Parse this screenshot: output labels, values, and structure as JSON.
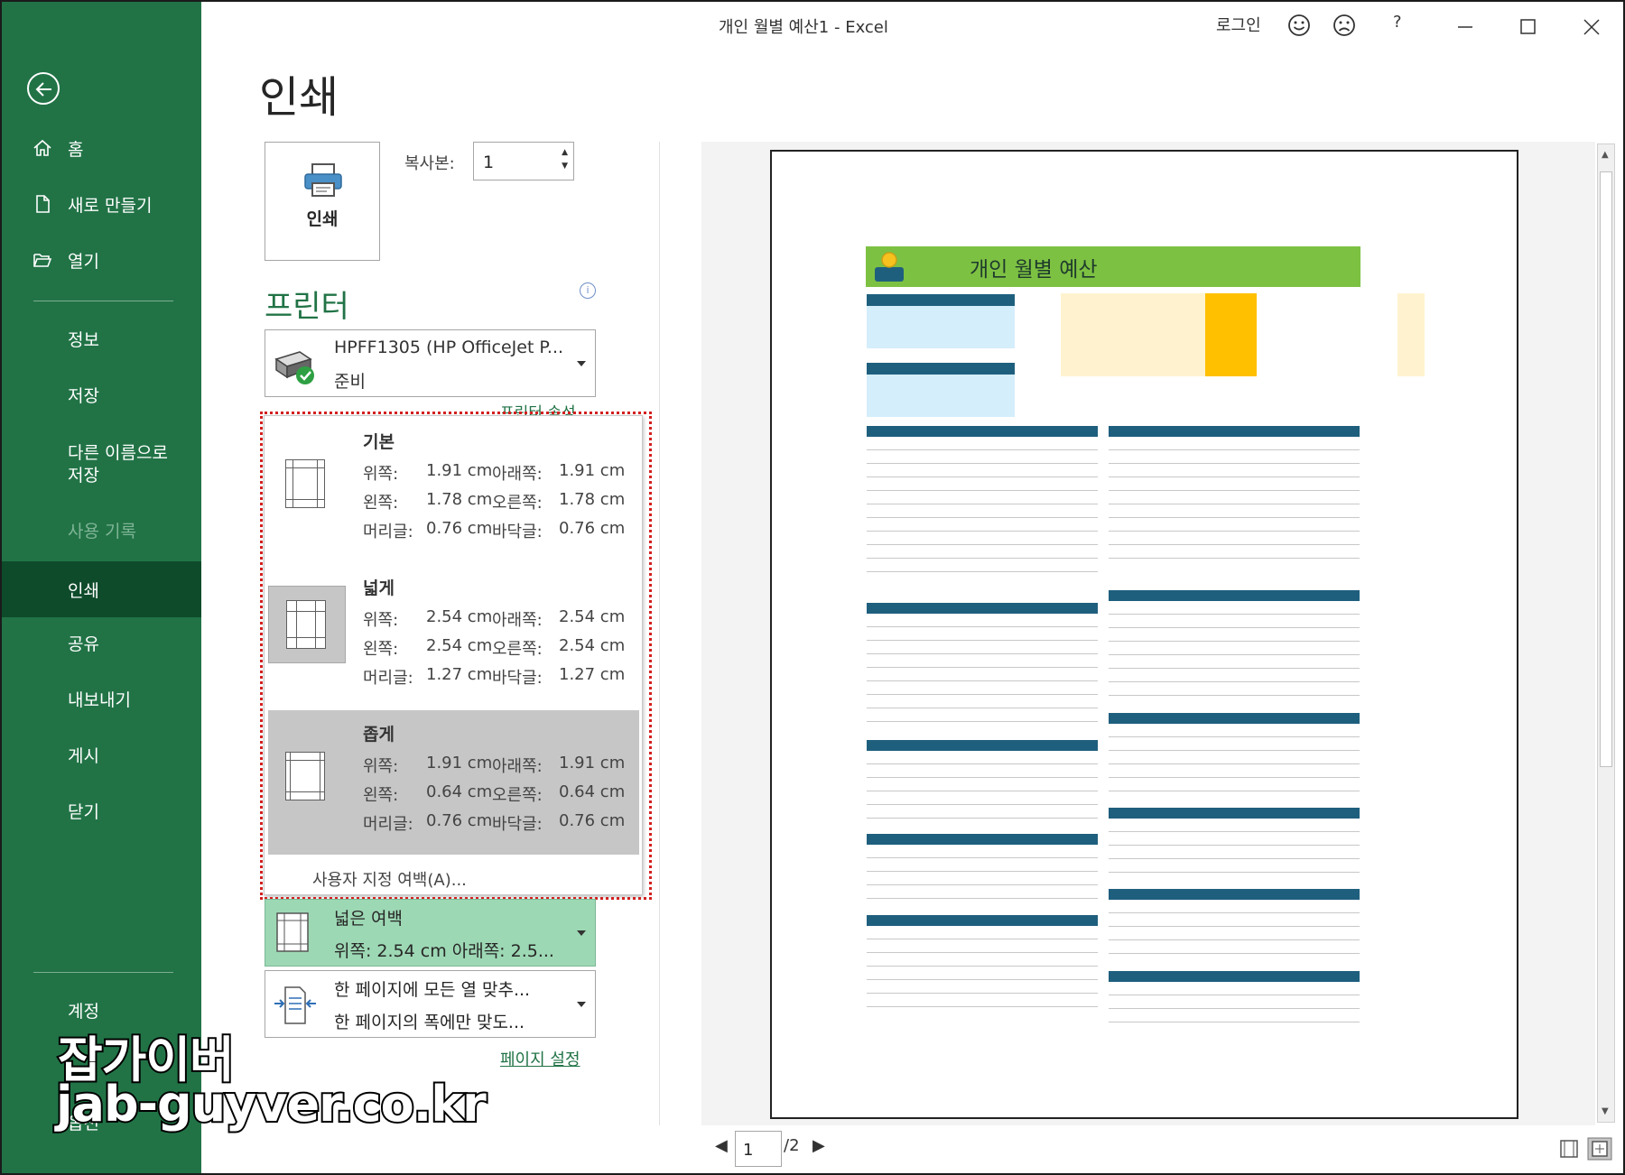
{
  "window": {
    "title": "개인 월별 예산1  -  Excel",
    "signin": "로그인",
    "help": "?"
  },
  "sidebar": {
    "items": [
      {
        "label": "홈",
        "icon": "home-icon"
      },
      {
        "label": "새로 만들기",
        "icon": "new-file-icon"
      },
      {
        "label": "열기",
        "icon": "open-folder-icon"
      },
      {
        "label": "정보"
      },
      {
        "label": "저장"
      },
      {
        "label": "다른 이름으로\n저장"
      },
      {
        "label": "사용 기록"
      },
      {
        "label": "인쇄"
      },
      {
        "label": "공유"
      },
      {
        "label": "내보내기"
      },
      {
        "label": "게시"
      },
      {
        "label": "닫기"
      },
      {
        "label": "계정"
      },
      {
        "label": "옵션"
      }
    ]
  },
  "print": {
    "heading": "인쇄",
    "button_label": "인쇄",
    "copies_label": "복사본:",
    "copies_value": "1",
    "printer_heading": "프린터",
    "printer_name": "HPFF1305 (HP OfficeJet P...",
    "printer_status": "준비",
    "printer_props": "프린터 속성"
  },
  "margins_menu": {
    "options": [
      {
        "name": "기본",
        "top_label": "위쪽:",
        "top": "1.91 cm",
        "bottom_label": "아래쪽:",
        "bottom": "1.91 cm",
        "left_label": "왼쪽:",
        "left": "1.78 cm",
        "right_label": "오른쪽:",
        "right": "1.78 cm",
        "header_label": "머리글:",
        "header": "0.76 cm",
        "footer_label": "바닥글:",
        "footer": "0.76 cm"
      },
      {
        "name": "넓게",
        "top_label": "위쪽:",
        "top": "2.54 cm",
        "bottom_label": "아래쪽:",
        "bottom": "2.54 cm",
        "left_label": "왼쪽:",
        "left": "2.54 cm",
        "right_label": "오른쪽:",
        "right": "2.54 cm",
        "header_label": "머리글:",
        "header": "1.27 cm",
        "footer_label": "바닥글:",
        "footer": "1.27 cm"
      },
      {
        "name": "좁게",
        "top_label": "위쪽:",
        "top": "1.91 cm",
        "bottom_label": "아래쪽:",
        "bottom": "1.91 cm",
        "left_label": "왼쪽:",
        "left": "0.64 cm",
        "right_label": "오른쪽:",
        "right": "0.64 cm",
        "header_label": "머리글:",
        "header": "0.76 cm",
        "footer_label": "바닥글:",
        "footer": "0.76 cm"
      }
    ],
    "custom": "사용자 지정 여백(A)..."
  },
  "settings": {
    "margins_title": "넓은 여백",
    "margins_detail": "위쪽: 2.54 cm 아래쪽: 2.5...",
    "scaling_title": "한 페이지에 모든 열 맞추...",
    "scaling_detail": "한 페이지의 폭에만 맞도...",
    "page_setup": "페이지 설정"
  },
  "preview": {
    "sheet_title": "개인 월별 예산",
    "page_current": "1",
    "page_total": "/2"
  },
  "watermark": {
    "line1": "잡가이버",
    "line2": "jab-guyver.co.kr"
  }
}
